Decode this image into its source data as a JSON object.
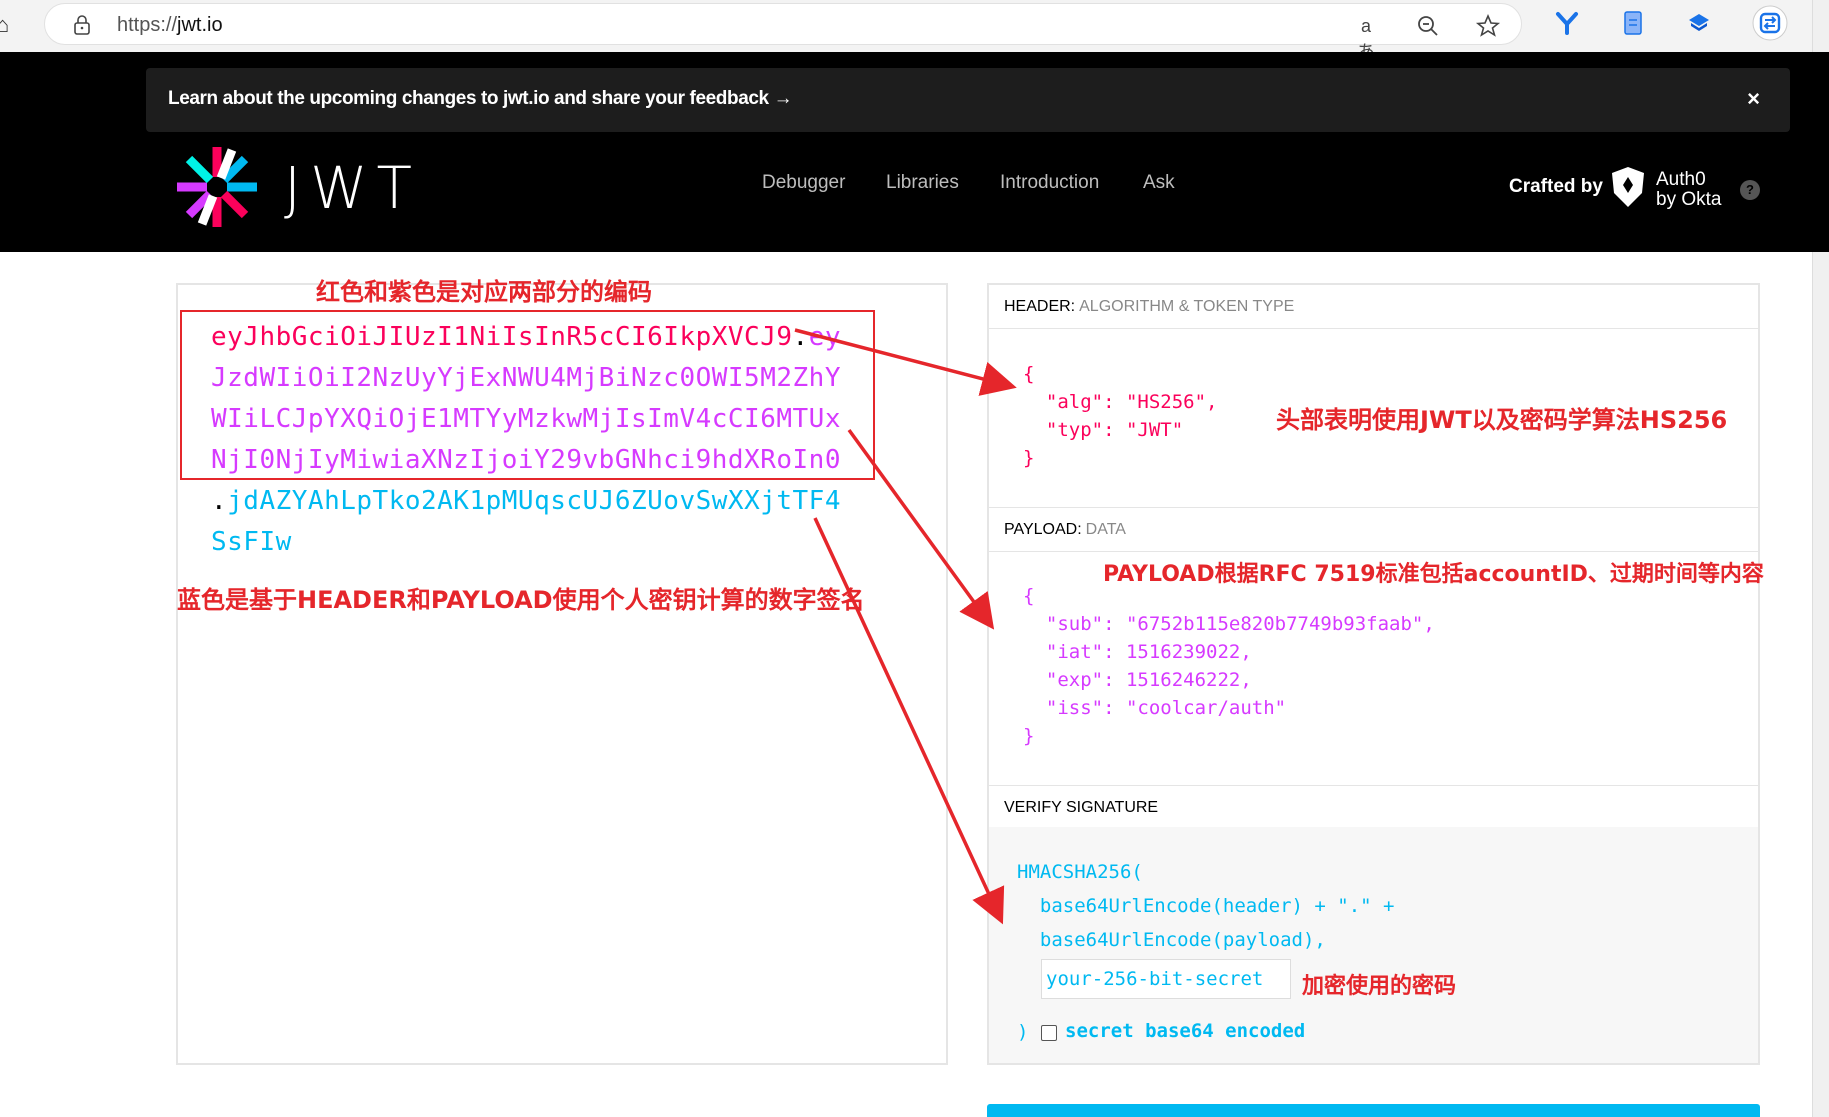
{
  "browser": {
    "url_scheme": "https://",
    "url_host": "jwt.io",
    "icons": [
      "home-icon",
      "lock-icon",
      "read-aloud-icon",
      "zoom-icon",
      "favorite-star-icon",
      "extension-icon",
      "document-icon",
      "shield-extension-icon",
      "sync-icon"
    ]
  },
  "banner": {
    "text": "Learn about the upcoming changes to jwt.io and share your feedback →",
    "close": "×"
  },
  "site": {
    "logo_text": "JWT",
    "nav": [
      "Debugger",
      "Libraries",
      "Introduction",
      "Ask"
    ],
    "crafted_by": "Crafted by",
    "auth0_line1": "Auth0",
    "auth0_line2": "by Okta",
    "help": "?"
  },
  "encoded": {
    "lines": [
      {
        "header": "eyJhbGciOiJIUzI1NiIsInR5cCI6IkpXVCJ9",
        "dot": ".",
        "payload": "ey"
      },
      {
        "payload": "JzdWIiOiI2NzUyYjExNWU4MjBiNzc0OWI5M2ZhY"
      },
      {
        "payload": "WIiLCJpYXQiOjE1MTYyMzkwMjIsImV4cCI6MTUx"
      },
      {
        "payload": "NjI0NjIyMiwiaXNzIjoiY29vbGNhci9hdXRoIn0"
      },
      {
        "dot": ".",
        "sig": "jdAZYAhLpTko2AK1pMUqscUJ6ZUovSwXXjtTF4"
      },
      {
        "sig": "SsFIw"
      }
    ]
  },
  "decoded": {
    "header_title": "HEADER:",
    "header_sub": "ALGORITHM & TOKEN TYPE",
    "header_json": [
      "{",
      "  \"alg\": \"HS256\",",
      "  \"typ\": \"JWT\"",
      "}"
    ],
    "payload_title": "PAYLOAD:",
    "payload_sub": "DATA",
    "payload_json": [
      "{",
      "  \"sub\": \"6752b115e820b7749b93faab\",",
      "  \"iat\": 1516239022,",
      "  \"exp\": 1516246222,",
      "  \"iss\": \"coolcar/auth\"",
      "}"
    ],
    "verify_title": "VERIFY SIGNATURE",
    "verify_lines": [
      "HMACSHA256(",
      "  base64UrlEncode(header) + \".\" +",
      "  base64UrlEncode(payload),"
    ],
    "secret_placeholder": "your-256-bit-secret",
    "close_paren": ")",
    "checkbox_label": "secret base64 encoded"
  },
  "annotations": {
    "top": "红色和紫色是对应两部分的编码",
    "header": "头部表明使用JWT以及密码学算法HS256",
    "payload": "PAYLOAD根据RFC 7519标准包括accountID、过期时间等内容",
    "signature": "蓝色是基于HEADER和PAYLOAD使用个人密钥计算的数字签名",
    "secret": "加密使用的密码"
  },
  "colors": {
    "header": "#fb015b",
    "payload": "#d63aff",
    "signature": "#00b9f1",
    "annotation": "#e5262b"
  }
}
